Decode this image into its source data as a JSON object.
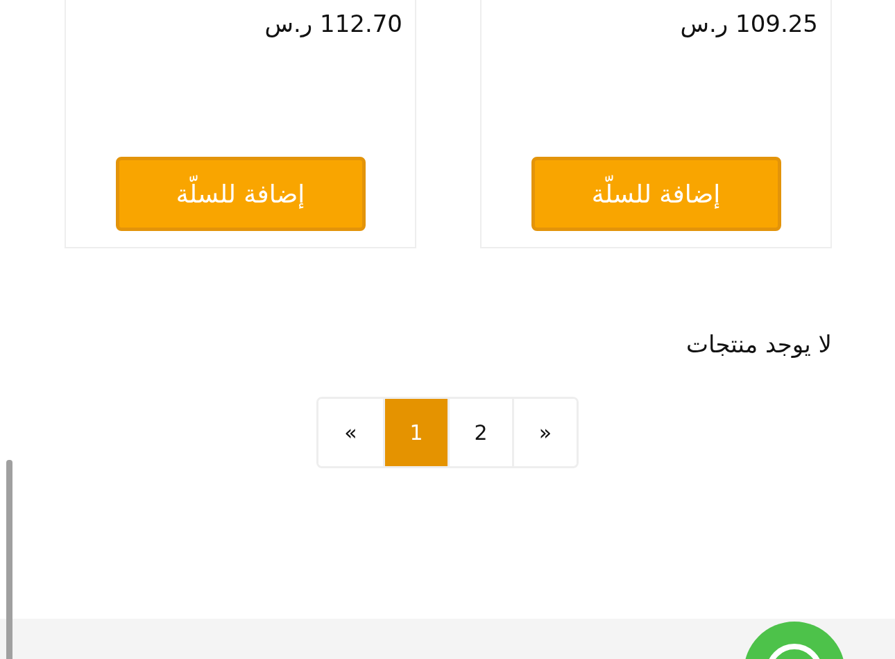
{
  "products": [
    {
      "price": "109.25 ر.س",
      "button": "إضافة للسلّة"
    },
    {
      "price": "112.70 ر.س",
      "button": "إضافة للسلّة"
    }
  ],
  "empty_message": "لا يوجد منتجات",
  "pagination": [
    {
      "label": "»",
      "selected": false
    },
    {
      "label": "2",
      "selected": false
    },
    {
      "label": "1",
      "selected": true
    },
    {
      "label": "«",
      "selected": false
    }
  ]
}
